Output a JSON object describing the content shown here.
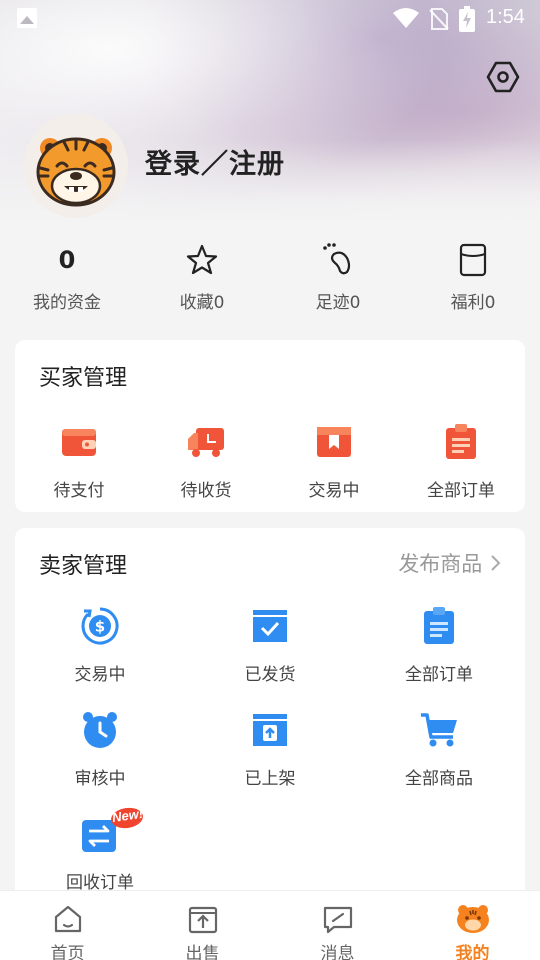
{
  "status_bar": {
    "time": "1:54"
  },
  "profile": {
    "login_label": "登录／注册"
  },
  "stats": [
    {
      "value": "0",
      "label": "我的资金"
    },
    {
      "label": "收藏0",
      "icon": "star-icon"
    },
    {
      "label": "足迹0",
      "icon": "footprint-icon"
    },
    {
      "label": "福利0",
      "icon": "gift-card-icon"
    }
  ],
  "buyer": {
    "title": "买家管理",
    "items": [
      {
        "label": "待支付",
        "icon": "wallet-icon"
      },
      {
        "label": "待收货",
        "icon": "truck-icon"
      },
      {
        "label": "交易中",
        "icon": "bookmark-box-icon"
      },
      {
        "label": "全部订单",
        "icon": "clipboard-icon"
      }
    ]
  },
  "seller": {
    "title": "卖家管理",
    "publish_label": "发布商品",
    "items": [
      {
        "label": "交易中",
        "icon": "dollar-cycle-icon"
      },
      {
        "label": "已发货",
        "icon": "shipped-box-icon"
      },
      {
        "label": "全部订单",
        "icon": "clipboard-list-icon"
      },
      {
        "label": "审核中",
        "icon": "alarm-clock-icon"
      },
      {
        "label": "已上架",
        "icon": "upload-box-icon"
      },
      {
        "label": "全部商品",
        "icon": "cart-icon"
      },
      {
        "label": "回收订单",
        "icon": "exchange-icon",
        "badge": "New!"
      }
    ]
  },
  "tabs": [
    {
      "label": "首页",
      "icon": "home-icon"
    },
    {
      "label": "出售",
      "icon": "sell-icon"
    },
    {
      "label": "消息",
      "icon": "message-icon"
    },
    {
      "label": "我的",
      "icon": "tiger-icon",
      "active": true
    }
  ],
  "colors": {
    "accent": "#f5821f",
    "blue": "#2f8cf0",
    "red": "#f0553a"
  }
}
